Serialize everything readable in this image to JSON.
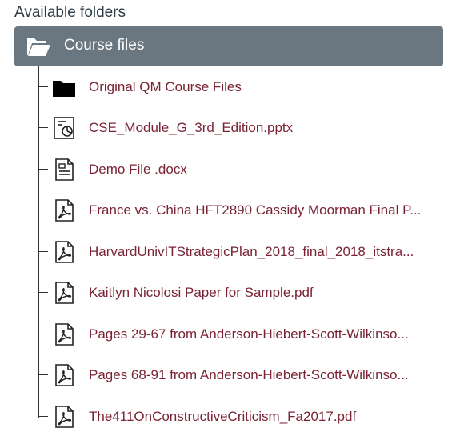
{
  "header": {
    "title": "Available folders"
  },
  "root": {
    "label": "Course files",
    "icon": "open-folder-icon"
  },
  "items": [
    {
      "label": "Original QM Course Files",
      "icon": "folder-icon"
    },
    {
      "label": "CSE_Module_G_3rd_Edition.pptx",
      "icon": "presentation-file-icon"
    },
    {
      "label": "Demo File .docx",
      "icon": "document-file-icon"
    },
    {
      "label": "France vs. China HFT2890 Cassidy Moorman Final P...",
      "icon": "pdf-file-icon"
    },
    {
      "label": "HarvardUnivITStrategicPlan_2018_final_2018_itstra...",
      "icon": "pdf-file-icon"
    },
    {
      "label": "Kaitlyn Nicolosi Paper for Sample.pdf",
      "icon": "pdf-file-icon"
    },
    {
      "label": "Pages 29-67 from Anderson-Hiebert-Scott-Wilkinso...",
      "icon": "pdf-file-icon"
    },
    {
      "label": "Pages 68-91 from Anderson-Hiebert-Scott-Wilkinso...",
      "icon": "pdf-file-icon"
    },
    {
      "label": "The411OnConstructiveCriticism_Fa2017.pdf",
      "icon": "pdf-file-icon"
    }
  ],
  "colors": {
    "root_bg": "#6b7780",
    "link": "#7a2335",
    "text": "#2d3b45"
  }
}
